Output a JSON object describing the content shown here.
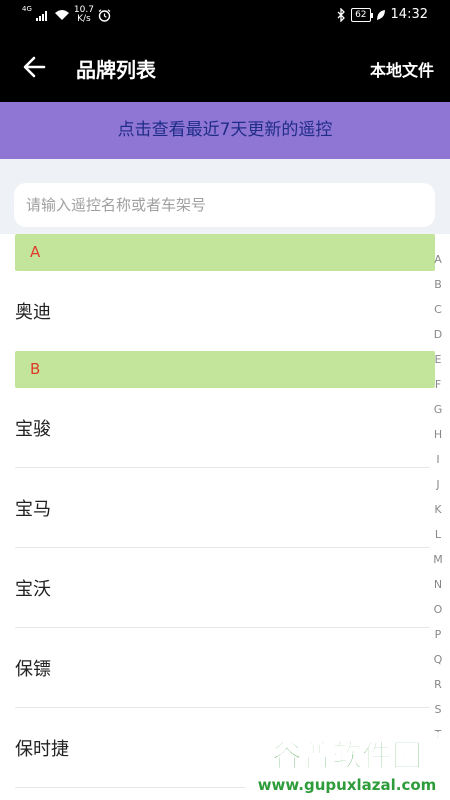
{
  "status_bar": {
    "signal_label": "4G",
    "speed_value": "10.7",
    "speed_unit": "K/s",
    "battery": "62",
    "time": "14:32"
  },
  "header": {
    "title": "品牌列表",
    "right_action": "本地文件"
  },
  "banner": {
    "text": "点击查看最近7天更新的遥控"
  },
  "search": {
    "placeholder": "请输入遥控名称或者车架号"
  },
  "sections": [
    {
      "letter": "A",
      "items": [
        "奥迪"
      ]
    },
    {
      "letter": "B",
      "items": [
        "宝骏",
        "宝马",
        "宝沃",
        "保镖",
        "保时捷"
      ]
    }
  ],
  "alphabet": [
    "A",
    "B",
    "C",
    "D",
    "E",
    "F",
    "G",
    "H",
    "I",
    "J",
    "K",
    "L",
    "M",
    "N",
    "O",
    "P",
    "Q",
    "R",
    "S",
    "T"
  ],
  "watermark": {
    "title": "谷普软件园",
    "url": "www.gupuxlazal.com"
  },
  "colors": {
    "banner_bg": "#9076d4",
    "section_bg": "#c3e49b",
    "section_letter": "#e03b2a",
    "watermark_green": "#2e9c3a"
  }
}
